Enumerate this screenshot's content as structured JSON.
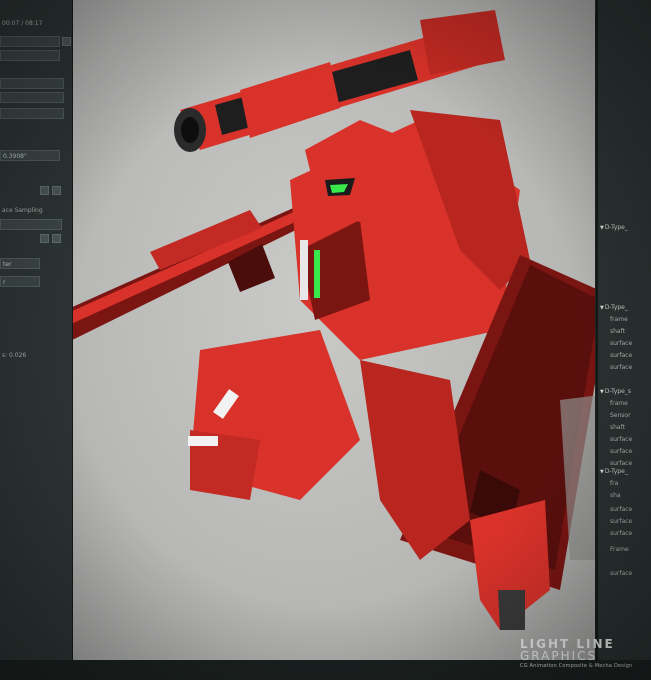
{
  "left_panel": {
    "header_value": "00:07 / 08:17",
    "rows": [
      {
        "kind": "field",
        "text": ""
      },
      {
        "kind": "field",
        "text": ""
      },
      {
        "kind": "field",
        "text": "0.3908\""
      },
      {
        "kind": "label",
        "text": "ace Sampling"
      },
      {
        "kind": "field",
        "text": "ter"
      },
      {
        "kind": "field",
        "text": "r"
      },
      {
        "kind": "label",
        "text": "s: 0.026"
      }
    ]
  },
  "right_panel": {
    "items": [
      {
        "kind": "parent",
        "text": "D-Type_"
      },
      {
        "kind": "parent",
        "text": "D-Type_"
      },
      {
        "kind": "child",
        "text": "frame"
      },
      {
        "kind": "child",
        "text": "shaft"
      },
      {
        "kind": "child",
        "text": "surface"
      },
      {
        "kind": "child",
        "text": "surface"
      },
      {
        "kind": "child",
        "text": "surface"
      },
      {
        "kind": "parent",
        "text": "D-Type_s"
      },
      {
        "kind": "child",
        "text": "frame"
      },
      {
        "kind": "child",
        "text": "Sensor"
      },
      {
        "kind": "child",
        "text": "shaft"
      },
      {
        "kind": "child",
        "text": "surface"
      },
      {
        "kind": "child",
        "text": "surface"
      },
      {
        "kind": "child",
        "text": "surface"
      },
      {
        "kind": "parent",
        "text": "D-Type_"
      },
      {
        "kind": "child",
        "text": "fra"
      },
      {
        "kind": "child",
        "text": "sha"
      },
      {
        "kind": "child",
        "text": "surface"
      },
      {
        "kind": "child",
        "text": "surface"
      },
      {
        "kind": "child",
        "text": "surface"
      },
      {
        "kind": "child",
        "text": "Frame"
      },
      {
        "kind": "child",
        "text": "surface"
      }
    ]
  },
  "logo": {
    "line1": "LIGHT LINE",
    "line2": "GRAPHICS",
    "line3": "CG Animation Composite & Mecha Design"
  },
  "colors": {
    "mech_red": "#d8322a",
    "mech_dark": "#7a1512",
    "mech_shadow": "#4a0d0b",
    "visor_green": "#39e84a",
    "viewport_gray": "#c4c5c3"
  },
  "icons": {
    "top_bar": [
      "camera-icon",
      "gear-icon",
      "grid-icon",
      "close-icon"
    ]
  }
}
